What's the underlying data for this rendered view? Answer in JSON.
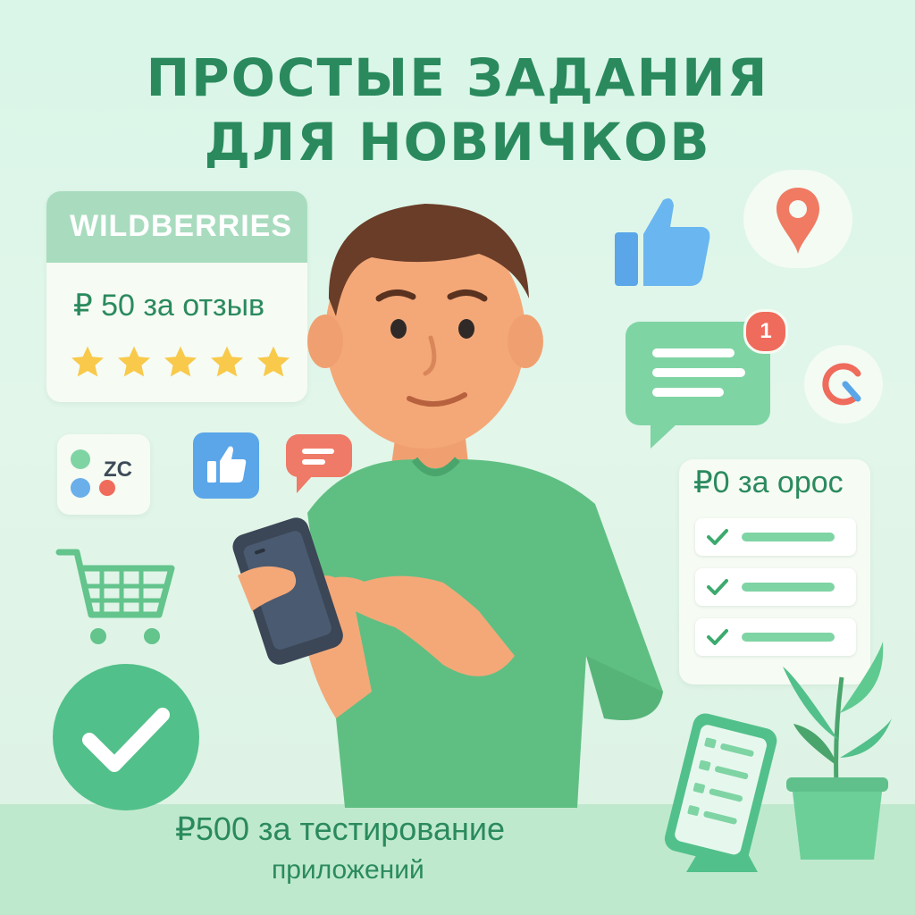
{
  "title": {
    "line1": "ПРОСТЫЕ ЗАДАНИЯ",
    "line2": "ДЛЯ НОВИЧКОВ"
  },
  "wildberries_card": {
    "brand": "WILDBERRIES",
    "price_text": "₽ 50 за отзыв",
    "rating_stars": 5
  },
  "survey_card": {
    "price_text": "₽0 за орос",
    "checked_rows": 3
  },
  "notification": {
    "count": "1"
  },
  "bottom": {
    "line1": "₽500 за тестирование",
    "line2": "приложений"
  },
  "logo_small": {
    "text": "ZC"
  },
  "colors": {
    "accent_green": "#2a8a5e",
    "light_green": "#7fd4a4",
    "star": "#f8c94a",
    "badge_red": "#ef6b5b",
    "like_blue": "#5aa6e8"
  },
  "icons": [
    "thumbs-up-icon",
    "map-pin-icon",
    "chat-bubble-icon",
    "google-icon",
    "like-square-icon",
    "small-chat-icon",
    "shopping-cart-icon",
    "checkmark-circle-icon",
    "tablet-icon",
    "plant-icon"
  ]
}
